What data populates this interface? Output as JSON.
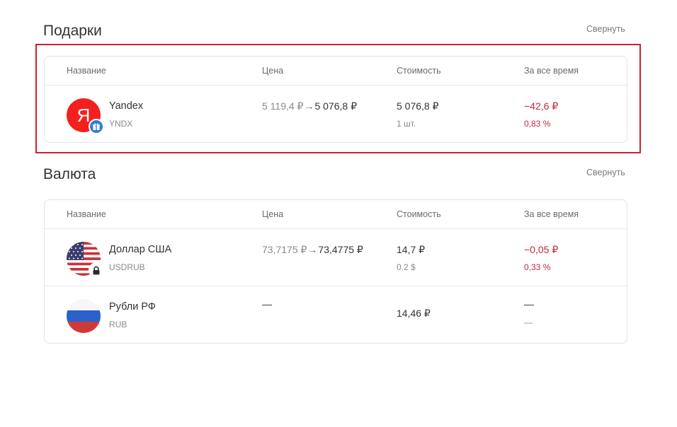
{
  "gifts": {
    "title": "Подарки",
    "collapse_label": "Свернуть",
    "columns": [
      "Название",
      "Цена",
      "Стоимость",
      "За все время"
    ],
    "rows": [
      {
        "name": "Yandex",
        "ticker": "YNDX",
        "logo_letter": "Я",
        "logo_color": "#f4201e",
        "badge_icon": "gift-icon",
        "price_old": "5 119,4 ₽",
        "price_arrow": "→",
        "price_new": "5 076,8 ₽",
        "cost": "5 076,8 ₽",
        "cost_sub": "1 шт.",
        "alltime": "−42,6 ₽",
        "alltime_pct": "0,83 %"
      }
    ]
  },
  "currency": {
    "title": "Валюта",
    "collapse_label": "Свернуть",
    "columns": [
      "Название",
      "Цена",
      "Стоимость",
      "За все время"
    ],
    "rows": [
      {
        "name": "Доллар США",
        "ticker": "USDRUB",
        "flag_icon": "us-flag-icon",
        "badge_icon": "lock-icon",
        "price_old": "73,7175 ₽",
        "price_arrow": "→",
        "price_new": "73,4775 ₽",
        "cost": "14,7 ₽",
        "cost_sub": "0.2 $",
        "alltime": "−0,05 ₽",
        "alltime_pct": "0,33 %"
      },
      {
        "name": "Рубли РФ",
        "ticker": "RUB",
        "flag_icon": "ru-flag-icon",
        "price": "—",
        "cost": "14,46 ₽",
        "alltime": "—",
        "alltime_pct": "—"
      }
    ]
  },
  "colors": {
    "negative": "#c0283e",
    "highlight_frame": "#c8232c",
    "badge_blue": "#2f7fd0"
  }
}
